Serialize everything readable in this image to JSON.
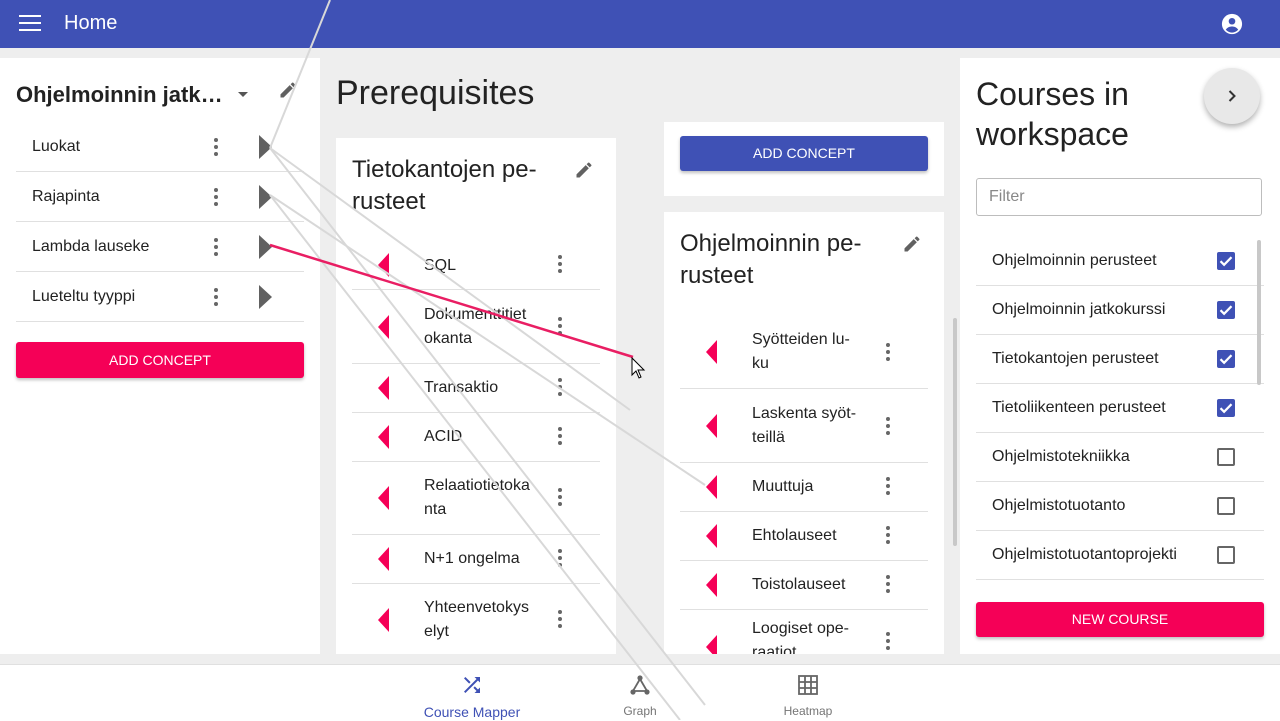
{
  "appbar": {
    "title": "Home",
    "menu_icon": "menu-icon",
    "account_icon": "account-circle-icon"
  },
  "workspace": {
    "title": "Ohjelmoinnin jatk…",
    "concepts": [
      {
        "label": "Luokat"
      },
      {
        "label": "Rajapinta"
      },
      {
        "label": "Lambda lauseke"
      },
      {
        "label": "Lueteltu tyyppi"
      }
    ],
    "add_concept": "ADD CONCEPT"
  },
  "prerequisites": {
    "title": "Prerequisites",
    "top_add_concept": "ADD CONCEPT",
    "courses": [
      {
        "title": "Tietokantojen perusteet",
        "title_lines": [
          "Tietokantojen pe-",
          "rusteet"
        ],
        "concepts": [
          {
            "lines": [
              "SQL"
            ]
          },
          {
            "lines": [
              "Dokumenttitiet",
              "okanta"
            ]
          },
          {
            "lines": [
              "Transaktio"
            ]
          },
          {
            "lines": [
              "ACID"
            ]
          },
          {
            "lines": [
              "Relaatiotietoka",
              "nta"
            ]
          },
          {
            "lines": [
              "N+1 ongelma"
            ]
          },
          {
            "lines": [
              "Yhteenvetokys",
              "elyt"
            ]
          }
        ]
      },
      {
        "title": "Ohjelmoinnin perusteet",
        "title_lines": [
          "Ohjelmoinnin pe-",
          "rusteet"
        ],
        "concepts": [
          {
            "lines": [
              "Syötteiden lu-",
              "ku"
            ]
          },
          {
            "lines": [
              "Laskenta syöt-",
              "teillä"
            ]
          },
          {
            "lines": [
              "Muuttuja"
            ]
          },
          {
            "lines": [
              "Ehtolauseet"
            ]
          },
          {
            "lines": [
              "Toistolauseet"
            ]
          },
          {
            "lines": [
              "Loogiset ope-",
              "raatiot"
            ]
          }
        ]
      }
    ]
  },
  "courses_panel": {
    "title_lines": [
      "Courses in",
      "workspace"
    ],
    "filter_placeholder": "Filter",
    "courses": [
      {
        "label": "Ohjelmoinnin perusteet",
        "checked": true
      },
      {
        "label": "Ohjelmoinnin jatkokurssi",
        "checked": true
      },
      {
        "label": "Tietokantojen perusteet",
        "checked": true
      },
      {
        "label": "Tietoliikenteen perusteet",
        "checked": true
      },
      {
        "label": "Ohjelmistotekniikka",
        "checked": false
      },
      {
        "label": "Ohjelmistotuotanto",
        "checked": false
      },
      {
        "label": "Ohjelmistotuotantoprojekti",
        "checked": false
      }
    ],
    "new_course": "NEW COURSE"
  },
  "bottom_nav": [
    {
      "label": "Course Mapper",
      "icon": "shuffle-icon",
      "active": true
    },
    {
      "label": "Graph",
      "icon": "graph-icon",
      "active": false
    },
    {
      "label": "Heatmap",
      "icon": "grid-icon",
      "active": false
    }
  ],
  "colors": {
    "primary": "#3f51b5",
    "accent": "#f50057",
    "link_active": "#e91e63",
    "link_faint": "#d8d8d8"
  }
}
